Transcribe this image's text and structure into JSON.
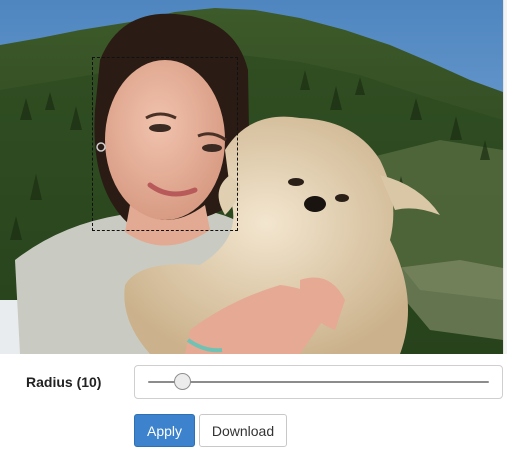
{
  "controls": {
    "radius_label": "Radius (10)",
    "radius_value": 10,
    "radius_min": 0,
    "radius_max": 100,
    "apply_label": "Apply",
    "download_label": "Download"
  },
  "colors": {
    "accent": "#3c82cc",
    "sky": "#6f9fcf"
  }
}
